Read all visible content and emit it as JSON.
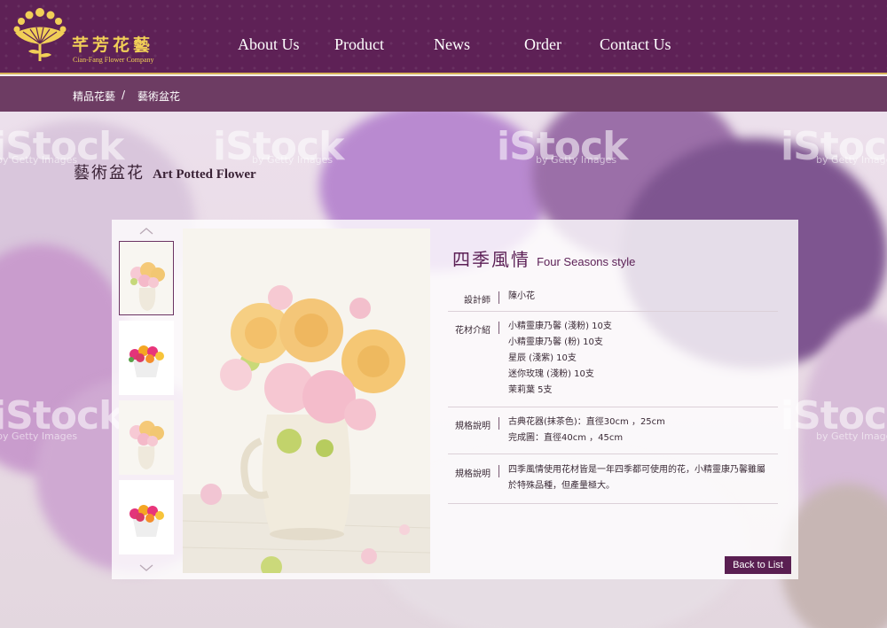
{
  "brand": {
    "name_cn": "芊芳花藝",
    "name_en": "Cian-Fang Flower Company",
    "logo_icon": "flower-fan-logo-icon",
    "gold": "#f1cf57",
    "purple": "#5e2156"
  },
  "nav": {
    "items": [
      {
        "label": "About Us"
      },
      {
        "label": "Product"
      },
      {
        "label": "News"
      },
      {
        "label": "Order"
      },
      {
        "label": "Contact Us"
      }
    ]
  },
  "breadcrumb": {
    "home": "精品花藝",
    "separator": "/",
    "current": "藝術盆花"
  },
  "page": {
    "title_cn": "藝術盆花",
    "title_en": "Art Potted Flower"
  },
  "watermark": {
    "text": "iStock",
    "sub": "by Getty Images"
  },
  "gallery": {
    "up_icon": "chevron-up-icon",
    "down_icon": "chevron-down-icon",
    "thumbs": [
      {
        "name": "thumb-pastel-roses",
        "active": true
      },
      {
        "name": "thumb-bright-roses",
        "active": false
      },
      {
        "name": "thumb-pastel-roses-2",
        "active": false
      },
      {
        "name": "thumb-bright-roses-2",
        "active": false
      }
    ]
  },
  "product": {
    "title_cn": "四季風情",
    "title_en": "Four Seasons style",
    "designer_label": "設計師",
    "designer": "陳小花",
    "materials_label": "花材介紹",
    "materials": [
      "小精靈康乃馨 (淺粉) 10支",
      "小精靈康乃馨 (粉) 10支",
      "星辰 (淺紫) 10支",
      "迷你玫瑰 (淺粉) 10支",
      "茉莉葉 5支"
    ],
    "spec_label": "規格說明",
    "spec": [
      "古典花器(抹茶色)：直徑30cm ，25cm",
      "完成圖：直徑40cm ，45cm"
    ],
    "note_label": "規格說明",
    "note": [
      "四季風情使用花材皆是一年四季都可使用的花，小精靈康乃馨雖屬",
      "於特殊品種，但產量極大。"
    ]
  },
  "actions": {
    "back_label": "Back to List"
  }
}
